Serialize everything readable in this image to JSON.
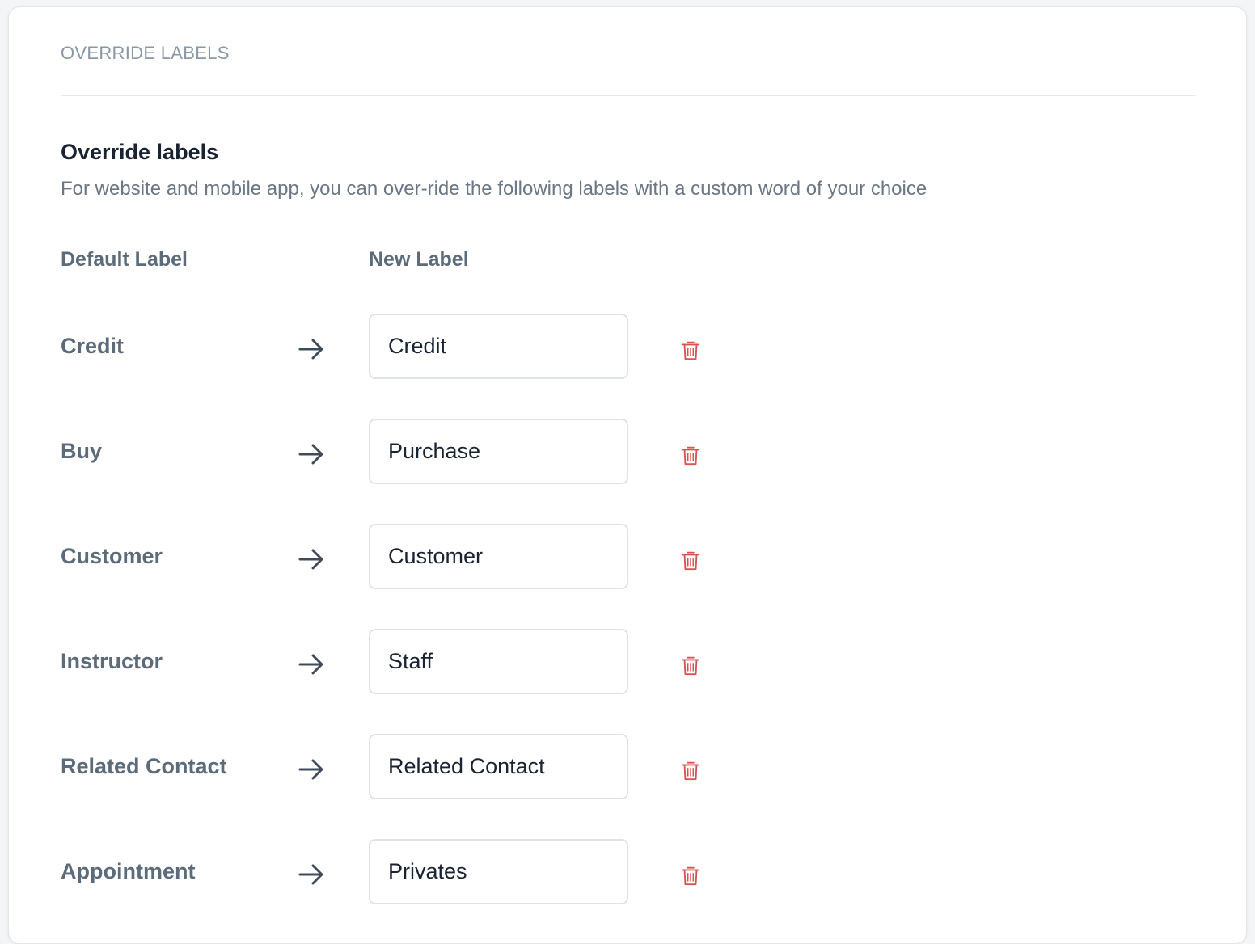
{
  "section": {
    "title": "OVERRIDE LABELS"
  },
  "intro": {
    "heading": "Override labels",
    "description": "For website and mobile app, you can over-ride the following labels with a custom word of your choice"
  },
  "columns": {
    "default": "Default Label",
    "new": "New Label"
  },
  "colors": {
    "delete_icon": "#d9534f",
    "arrow": "#3f4b5a"
  },
  "icons": {
    "arrow": "arrow-right-icon",
    "delete": "trash-icon"
  },
  "rows": [
    {
      "default": "Credit",
      "value": "Credit"
    },
    {
      "default": "Buy",
      "value": "Purchase"
    },
    {
      "default": "Customer",
      "value": "Customer"
    },
    {
      "default": "Instructor",
      "value": "Staff"
    },
    {
      "default": "Related Contact",
      "value": "Related Contact"
    },
    {
      "default": "Appointment",
      "value": "Privates"
    }
  ]
}
